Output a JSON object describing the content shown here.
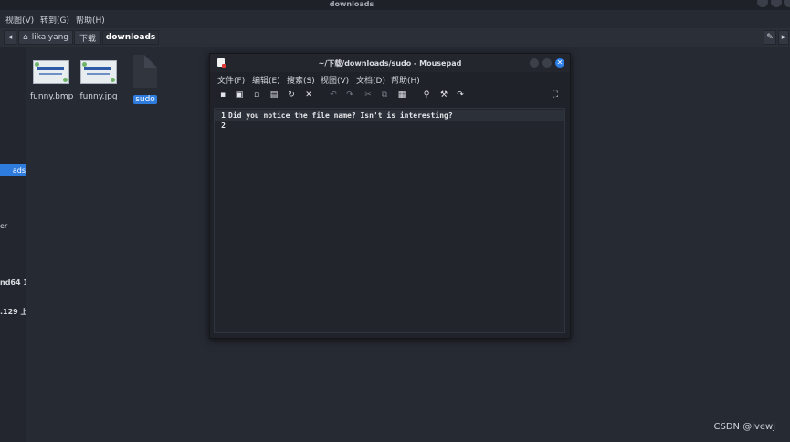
{
  "screen": {
    "title": "downloads"
  },
  "filemanager": {
    "menu": [
      "视图(V)",
      "转到(G)",
      "帮助(H)"
    ],
    "path": {
      "home": "likaiyang",
      "seg1": "下载",
      "seg2": "downloads"
    },
    "sidebar": {
      "active": "ads",
      "items": [
        "er",
        "nd64 1",
        ".129 上|"
      ]
    },
    "files": [
      {
        "name": "funny.bmp",
        "thumb_text": "YOU ARE DOING"
      },
      {
        "name": "funny.jpg",
        "thumb_text": "YOU ARE DOING"
      },
      {
        "name": "sudo"
      }
    ]
  },
  "editor": {
    "title": "~/下载/downloads/sudo - Mousepad",
    "menu": [
      "文件(F)",
      "编辑(E)",
      "搜索(S)",
      "视图(V)",
      "文档(D)",
      "帮助(H)"
    ],
    "lines": [
      {
        "num": "1",
        "text": "Did you notice the file name? Isn't is interesting?"
      },
      {
        "num": "2",
        "text": ""
      }
    ]
  },
  "watermark": "CSDN @lvewj"
}
